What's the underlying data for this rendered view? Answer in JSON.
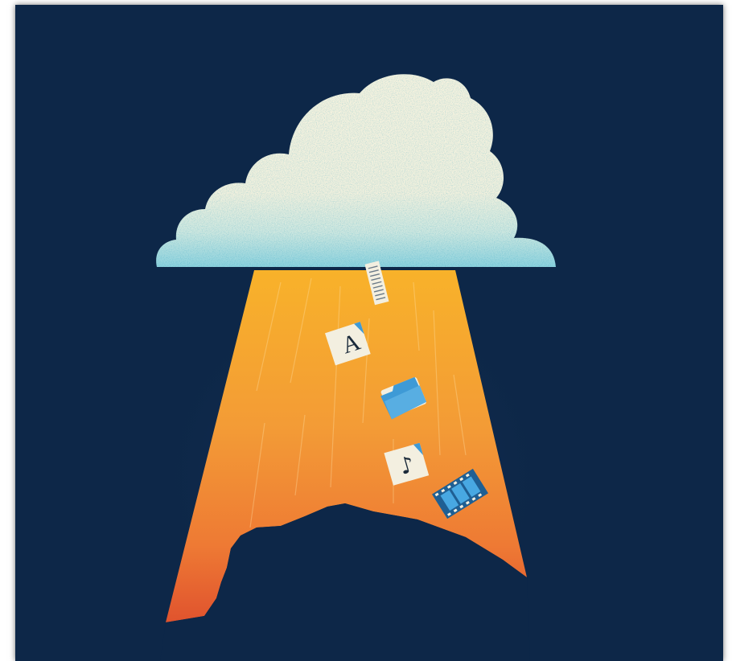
{
  "artwork": {
    "colors": {
      "background": "#0d2748",
      "cloud_top": "#f7f3df",
      "cloud_bottom": "#8fd3de",
      "cloud_speckle": "#5fbfd0",
      "beam_top": "#f8b22a",
      "beam_mid": "#f39b36",
      "beam_bottom": "#e0532e",
      "silhouette": "#0d2748",
      "file_paper": "#f3efe0",
      "file_blue": "#3e9ad6"
    },
    "icons": [
      "document-icon",
      "font-file-icon",
      "folder-icon",
      "music-file-icon",
      "film-strip-icon"
    ],
    "font_icon_glyph": "A",
    "music_icon_glyph": "♪"
  }
}
